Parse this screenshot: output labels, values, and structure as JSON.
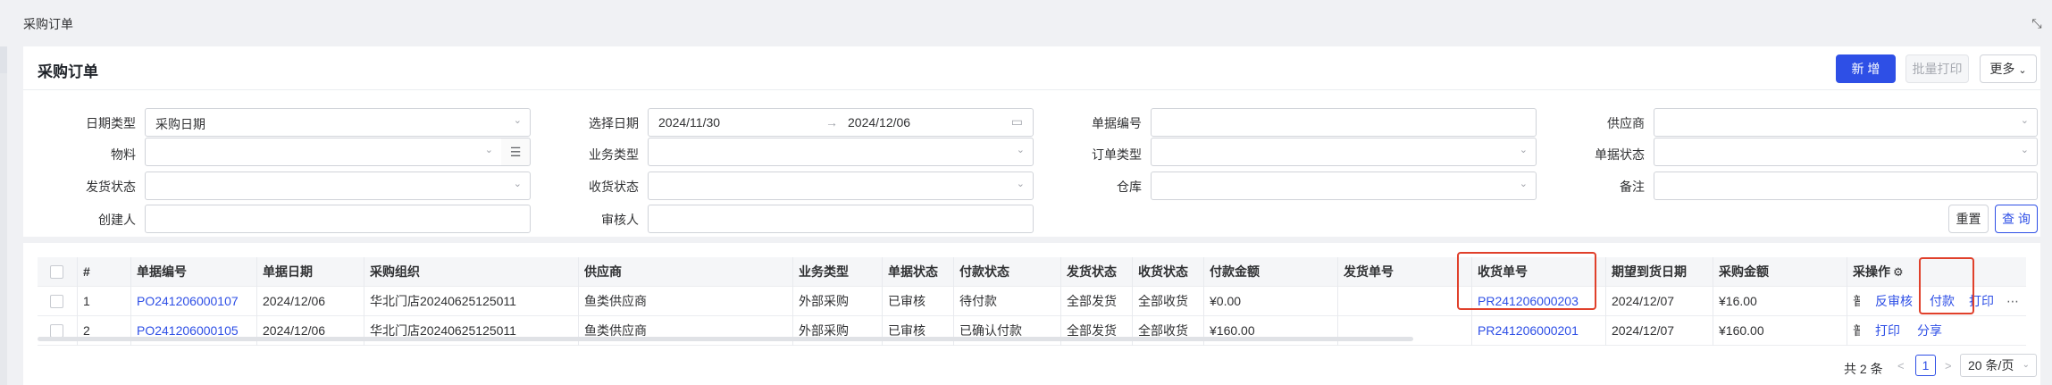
{
  "tab": {
    "title": "采购订单",
    "expand_icon": "expand-icon"
  },
  "header": {
    "title": "采购订单",
    "new_label": "新 增",
    "batch_print_label": "批量打印",
    "more_label": "更多",
    "accent_color": "#2e4fe6"
  },
  "filters": {
    "date_type": {
      "label": "日期类型",
      "value": "采购日期"
    },
    "select_date": {
      "label": "选择日期",
      "start": "2024/11/30",
      "end": "2024/12/06"
    },
    "doc_no": {
      "label": "单据编号",
      "value": ""
    },
    "supplier": {
      "label": "供应商",
      "value": ""
    },
    "material": {
      "label": "物料",
      "value": ""
    },
    "biz_type": {
      "label": "业务类型",
      "value": ""
    },
    "order_type": {
      "label": "订单类型",
      "value": ""
    },
    "doc_status": {
      "label": "单据状态",
      "value": ""
    },
    "ship_status": {
      "label": "发货状态",
      "value": ""
    },
    "recv_status": {
      "label": "收货状态",
      "value": ""
    },
    "warehouse": {
      "label": "仓库",
      "value": ""
    },
    "remark": {
      "label": "备注",
      "value": ""
    },
    "creator": {
      "label": "创建人",
      "value": ""
    },
    "auditor": {
      "label": "审核人",
      "value": ""
    },
    "reset_label": "重置",
    "query_label": "查 询"
  },
  "table": {
    "columns": {
      "no": "#",
      "doc_no": "单据编号",
      "doc_date": "单据日期",
      "org": "采购组织",
      "supplier": "供应商",
      "biz_type": "业务类型",
      "doc_status": "单据状态",
      "pay_status": "付款状态",
      "ship_status": "发货状态",
      "recv_status": "收货状态",
      "pay_amount": "付款金额",
      "ship_no": "发货单号",
      "recv_no": "收货单号",
      "expect_date": "期望到货日期",
      "amount": "采购金额",
      "trunc": "采",
      "ops": "操作"
    },
    "rows": [
      {
        "no": "1",
        "doc_no": "PO241206000107",
        "doc_date": "2024/12/06",
        "org": "华北门店20240625125011",
        "supplier": "鱼类供应商",
        "biz_type": "外部采购",
        "doc_status": "已审核",
        "pay_status": "待付款",
        "ship_status": "全部发货",
        "recv_status": "全部收货",
        "pay_amount": "¥0.00",
        "ship_no": "",
        "recv_no": "PR241206000203",
        "expect_date": "2024/12/07",
        "amount": "¥16.00",
        "trunc": "普",
        "op1": "反审核",
        "op2": "付款",
        "op3": "打印",
        "op_more": "⋯"
      },
      {
        "no": "2",
        "doc_no": "PO241206000105",
        "doc_date": "2024/12/06",
        "org": "华北门店20240625125011",
        "supplier": "鱼类供应商",
        "biz_type": "外部采购",
        "doc_status": "已审核",
        "pay_status": "已确认付款",
        "ship_status": "全部发货",
        "recv_status": "全部收货",
        "pay_amount": "¥160.00",
        "ship_no": "",
        "recv_no": "PR241206000201",
        "expect_date": "2024/12/07",
        "amount": "¥160.00",
        "trunc": "普",
        "op1": "打印",
        "op2": "分享"
      }
    ]
  },
  "pager": {
    "total": "共 2 条",
    "current": "1",
    "size": "20 条/页"
  },
  "highlight_color": "#e0402b"
}
